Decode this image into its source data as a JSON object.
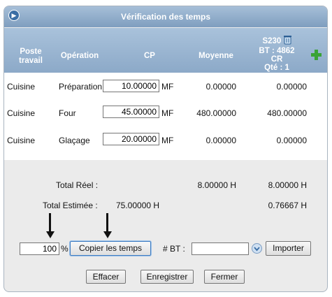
{
  "title": "Vérification des temps",
  "header": {
    "col_poste": "Poste travail",
    "col_operation": "Opération",
    "col_cp": "CP",
    "col_moyenne": "Moyenne",
    "bt_line1": "S230",
    "bt_line2": "BT : 4862",
    "bt_line3": "CR",
    "bt_line4": "Qté : 1"
  },
  "rows": [
    {
      "poste": "Cuisine",
      "operation": "Préparation",
      "cp": "10.00000",
      "unit": "MF",
      "moyenne": "0.00000",
      "bt": "0.00000"
    },
    {
      "poste": "Cuisine",
      "operation": "Four",
      "cp": "45.00000",
      "unit": "MF",
      "moyenne": "480.00000",
      "bt": "480.00000"
    },
    {
      "poste": "Cuisine",
      "operation": "Glaçage",
      "cp": "20.00000",
      "unit": "MF",
      "moyenne": "0.00000",
      "bt": "0.00000"
    }
  ],
  "totals": {
    "reel_label": "Total Réel :",
    "reel_moyenne": "8.00000 H",
    "reel_bt": "8.00000 H",
    "estimee_label": "Total Estimée :",
    "estimee_cp": "75.00000 H",
    "estimee_bt": "0.76667 H"
  },
  "controls": {
    "percent_value": "100",
    "percent_sign": "%",
    "copy_label": "Copier les temps",
    "bt_label": "# BT :",
    "bt_value": "",
    "import_label": "Importer"
  },
  "footer": {
    "clear_label": "Effacer",
    "save_label": "Enregistrer",
    "close_label": "Fermer"
  },
  "colors": {
    "header_bg": "#8ca9c8",
    "panel_bg": "#ebebeb",
    "add_icon": "#3aa335"
  }
}
